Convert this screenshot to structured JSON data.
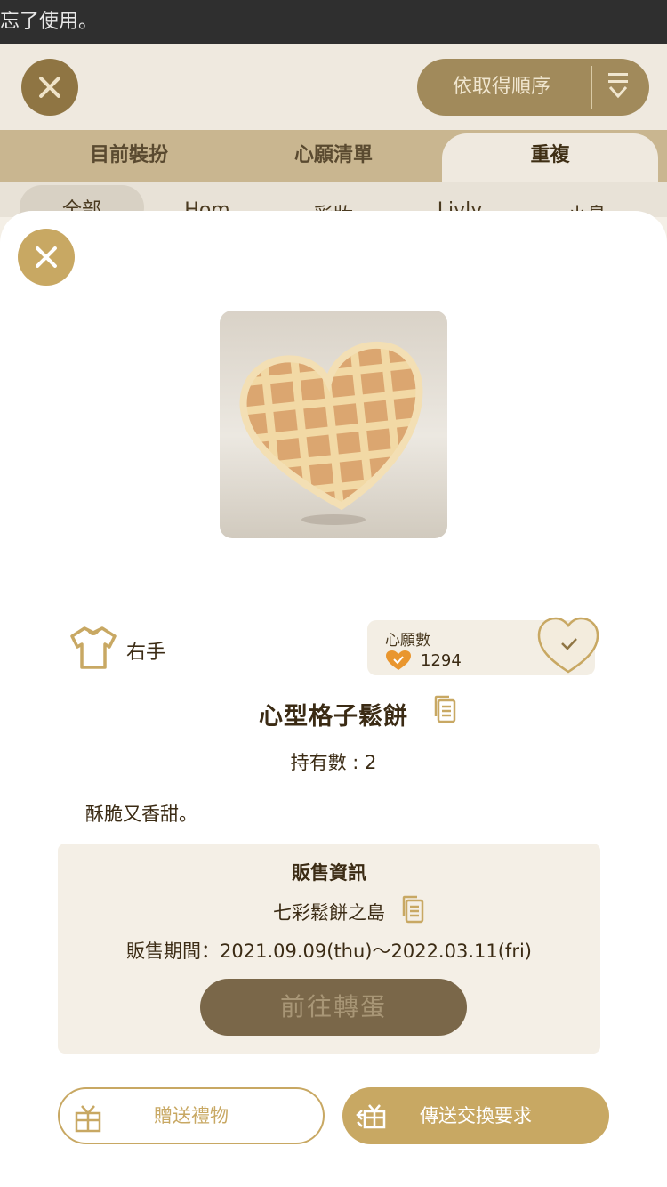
{
  "status_bar": {
    "text": "別忘了使用。"
  },
  "background": {
    "sort_label": "依取得順序",
    "tabs": [
      {
        "label": "目前裝扮"
      },
      {
        "label": "心願清單"
      },
      {
        "label": "重複"
      }
    ],
    "subtabs": [
      {
        "label": "全部"
      },
      {
        "label": "Hom"
      },
      {
        "label": "彩妝"
      },
      {
        "label": "Livly"
      },
      {
        "label": "小島"
      }
    ]
  },
  "item": {
    "slot_label": "右手",
    "wish_label": "心願數",
    "wish_count": "1294",
    "name": "心型格子鬆餅",
    "owned": "持有數 : 2",
    "description": "酥脆又香甜。"
  },
  "sale": {
    "title": "販售資訊",
    "shop": "七彩鬆餅之島",
    "period": "販售期間：2021.09.09(thu)～2022.03.11(fri)",
    "go_label": "前往轉蛋"
  },
  "actions": {
    "gift_label": "贈送禮物",
    "trade_label": "傳送交換要求"
  },
  "colors": {
    "accent_gold": "#c8a863",
    "text_brown": "#3b2b14",
    "panel_bg": "#f4efe6",
    "wish_orange": "#e9962e"
  },
  "icons": [
    "close-icon",
    "sort-icon",
    "shirt-icon",
    "heart-check-icon",
    "document-icon",
    "gift-icon",
    "trade-icon"
  ]
}
